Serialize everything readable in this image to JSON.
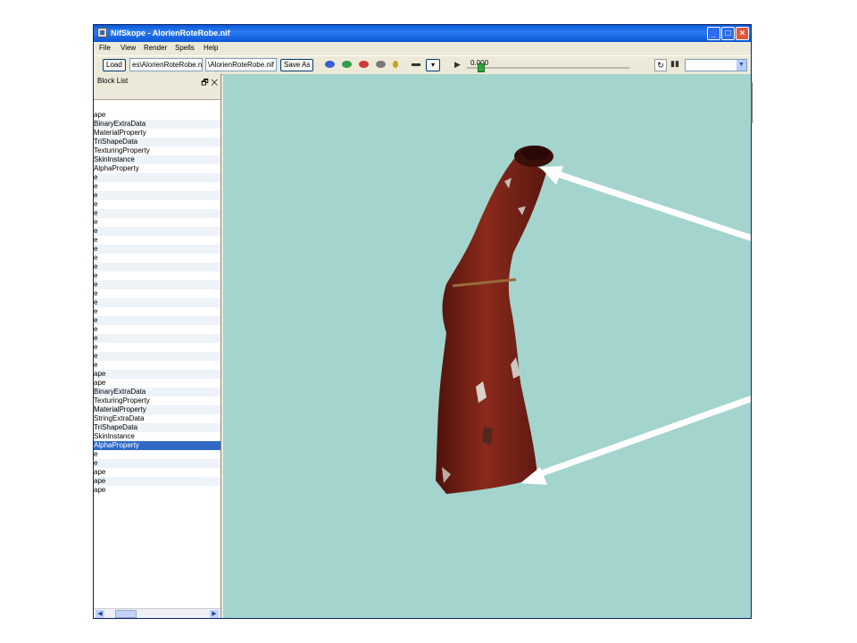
{
  "window": {
    "title": "NifSkope - AlorienRoteRobe.nif"
  },
  "menu": [
    "File",
    "View",
    "Render",
    "Spells",
    "Help"
  ],
  "toolbar": {
    "load_label": "Load",
    "load_path": "es\\AlorienRoteRobe.nif",
    "save_path": "\\AlorienRoteRobe.nif",
    "save_as_label": "Save As",
    "anim_time": "0.000"
  },
  "block_list": {
    "title": "Block List",
    "rows": [
      "ape",
      "BinaryExtraData",
      "MaterialProperty",
      "TriShapeData",
      "TexturingProperty",
      "SkinInstance",
      "AlphaProperty",
      "e",
      "e",
      "e",
      "e",
      "e",
      "e",
      "e",
      "e",
      "e",
      "e",
      "e",
      "e",
      "e",
      "e",
      "e",
      "e",
      "e",
      "e",
      "e",
      "e",
      "e",
      "e",
      "ape",
      "ape",
      "BinaryExtraData",
      "TexturingProperty",
      "MaterialProperty",
      "StringExtraData",
      "TriShapeData",
      "SkinInstance",
      "AlphaProperty",
      "e",
      "e",
      "ape",
      "ape",
      "ape"
    ],
    "selected_index": 37
  },
  "viewport": {
    "background": "#a3d4cd",
    "robe_color": "#7a1f14"
  }
}
